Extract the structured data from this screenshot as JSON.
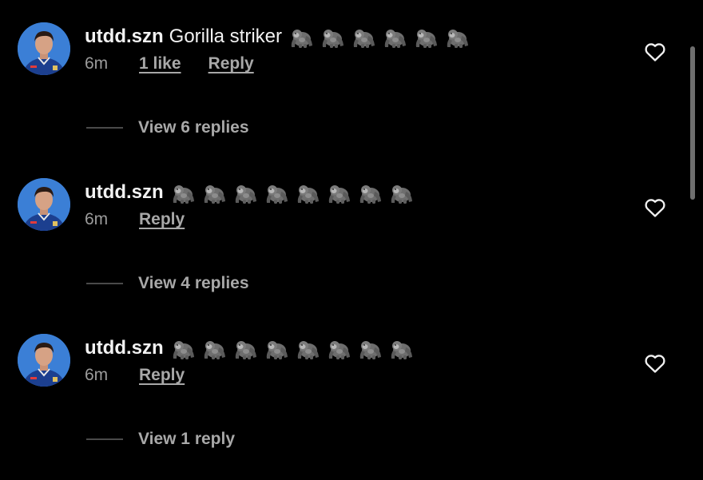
{
  "comments": [
    {
      "username": "utdd.szn",
      "text": "Gorilla striker",
      "emoji_count": 6,
      "time": "6m",
      "likes": "1 like",
      "reply_label": "Reply",
      "view_replies": "View 6 replies"
    },
    {
      "username": "utdd.szn",
      "text": "",
      "emoji_count": 8,
      "time": "6m",
      "reply_label": "Reply",
      "view_replies": "View 4 replies"
    },
    {
      "username": "utdd.szn",
      "text": "",
      "emoji_count": 8,
      "time": "6m",
      "reply_label": "Reply",
      "view_replies": "View 1 reply"
    }
  ],
  "icons": {
    "avatar": "avatar-photo",
    "emoji": "gorilla-icon",
    "like": "heart-outline-icon"
  },
  "colors": {
    "background": "#000000",
    "primary_text": "#f2f2f2",
    "secondary_text": "#a8a8a8"
  }
}
